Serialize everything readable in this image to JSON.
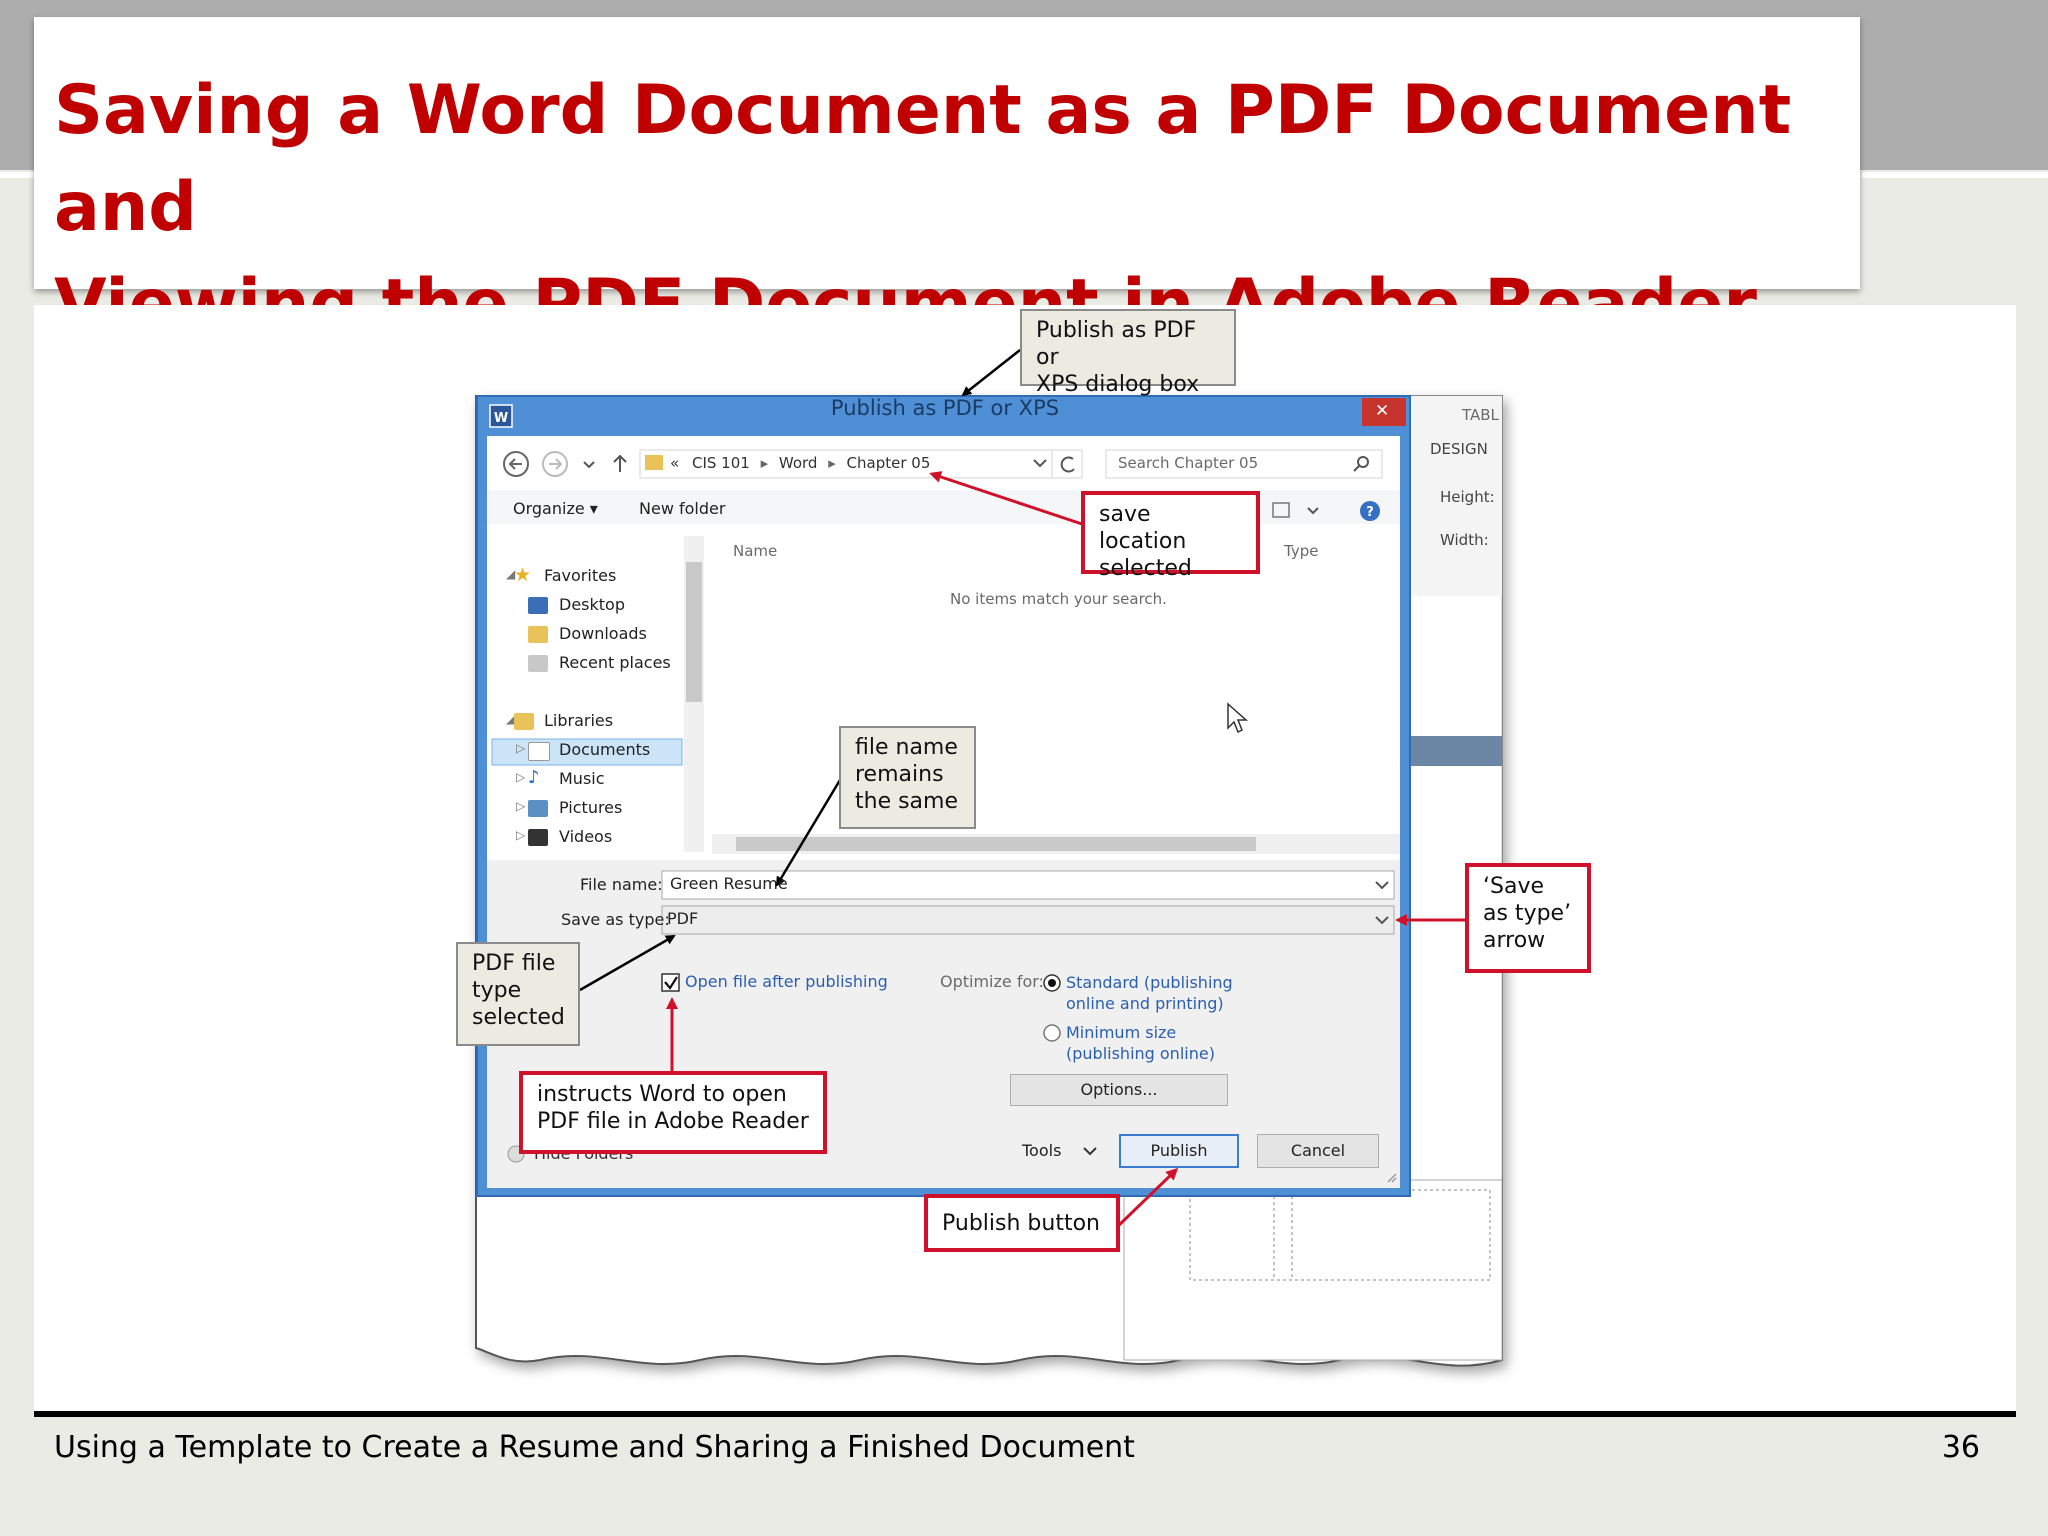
{
  "slide": {
    "title_line1": "Saving a Word Document as a PDF Document and",
    "title_line2": "Viewing the PDF Document in Adobe Reader",
    "footer": "Using a Template to Create a Resume and Sharing a Finished Document",
    "page_number": "36"
  },
  "dialog": {
    "title": "Publish as PDF or XPS",
    "close_glyph": "✕",
    "breadcrumb": [
      "«",
      "CIS 101",
      "Word",
      "Chapter 05"
    ],
    "search_placeholder": "Search Chapter 05",
    "toolbar": {
      "organize": "Organize ▾",
      "new_folder": "New folder"
    },
    "columns": {
      "name": "Name",
      "type": "Type"
    },
    "empty_message": "No items match your search.",
    "nav": {
      "favorites": "Favorites",
      "desktop": "Desktop",
      "downloads": "Downloads",
      "recent": "Recent places",
      "libraries": "Libraries",
      "documents": "Documents",
      "music": "Music",
      "pictures": "Pictures",
      "videos": "Videos"
    },
    "file_name_label": "File name:",
    "file_name_value": "Green Resume",
    "save_type_label": "Save as type:",
    "save_type_value": "PDF",
    "open_after_label": "Open file after publishing",
    "optimize_label": "Optimize for:",
    "standard_line1": "Standard (publishing",
    "standard_line2": "online and printing)",
    "minimum_line1": "Minimum size",
    "minimum_line2": "(publishing online)",
    "options_button": "Options...",
    "hide_folders": "Hide Folders",
    "tools": "Tools",
    "publish_button": "Publish",
    "cancel_button": "Cancel"
  },
  "ribbon_behind": {
    "tab": "TABL",
    "design": "DESIGN",
    "height_label": "Height:",
    "width_label": "Width:"
  },
  "callouts": {
    "dialog_box": [
      "Publish as PDF or",
      "XPS dialog box"
    ],
    "save_location": [
      "save location",
      "selected"
    ],
    "file_name": [
      "file name",
      "remains",
      "the same"
    ],
    "save_as_type_arrow": [
      "‘Save",
      "as type’",
      "arrow"
    ],
    "pdf_type": [
      "PDF file",
      "type",
      "selected"
    ],
    "open_in_reader": [
      "instructs Word to open",
      "PDF file in Adobe Reader"
    ],
    "publish_button": [
      "Publish button"
    ]
  },
  "colors": {
    "title_red": "#c00000",
    "callout_red": "#d0112b",
    "window_frame": "#4f8fd6",
    "selection_blue": "#cce4f7"
  }
}
